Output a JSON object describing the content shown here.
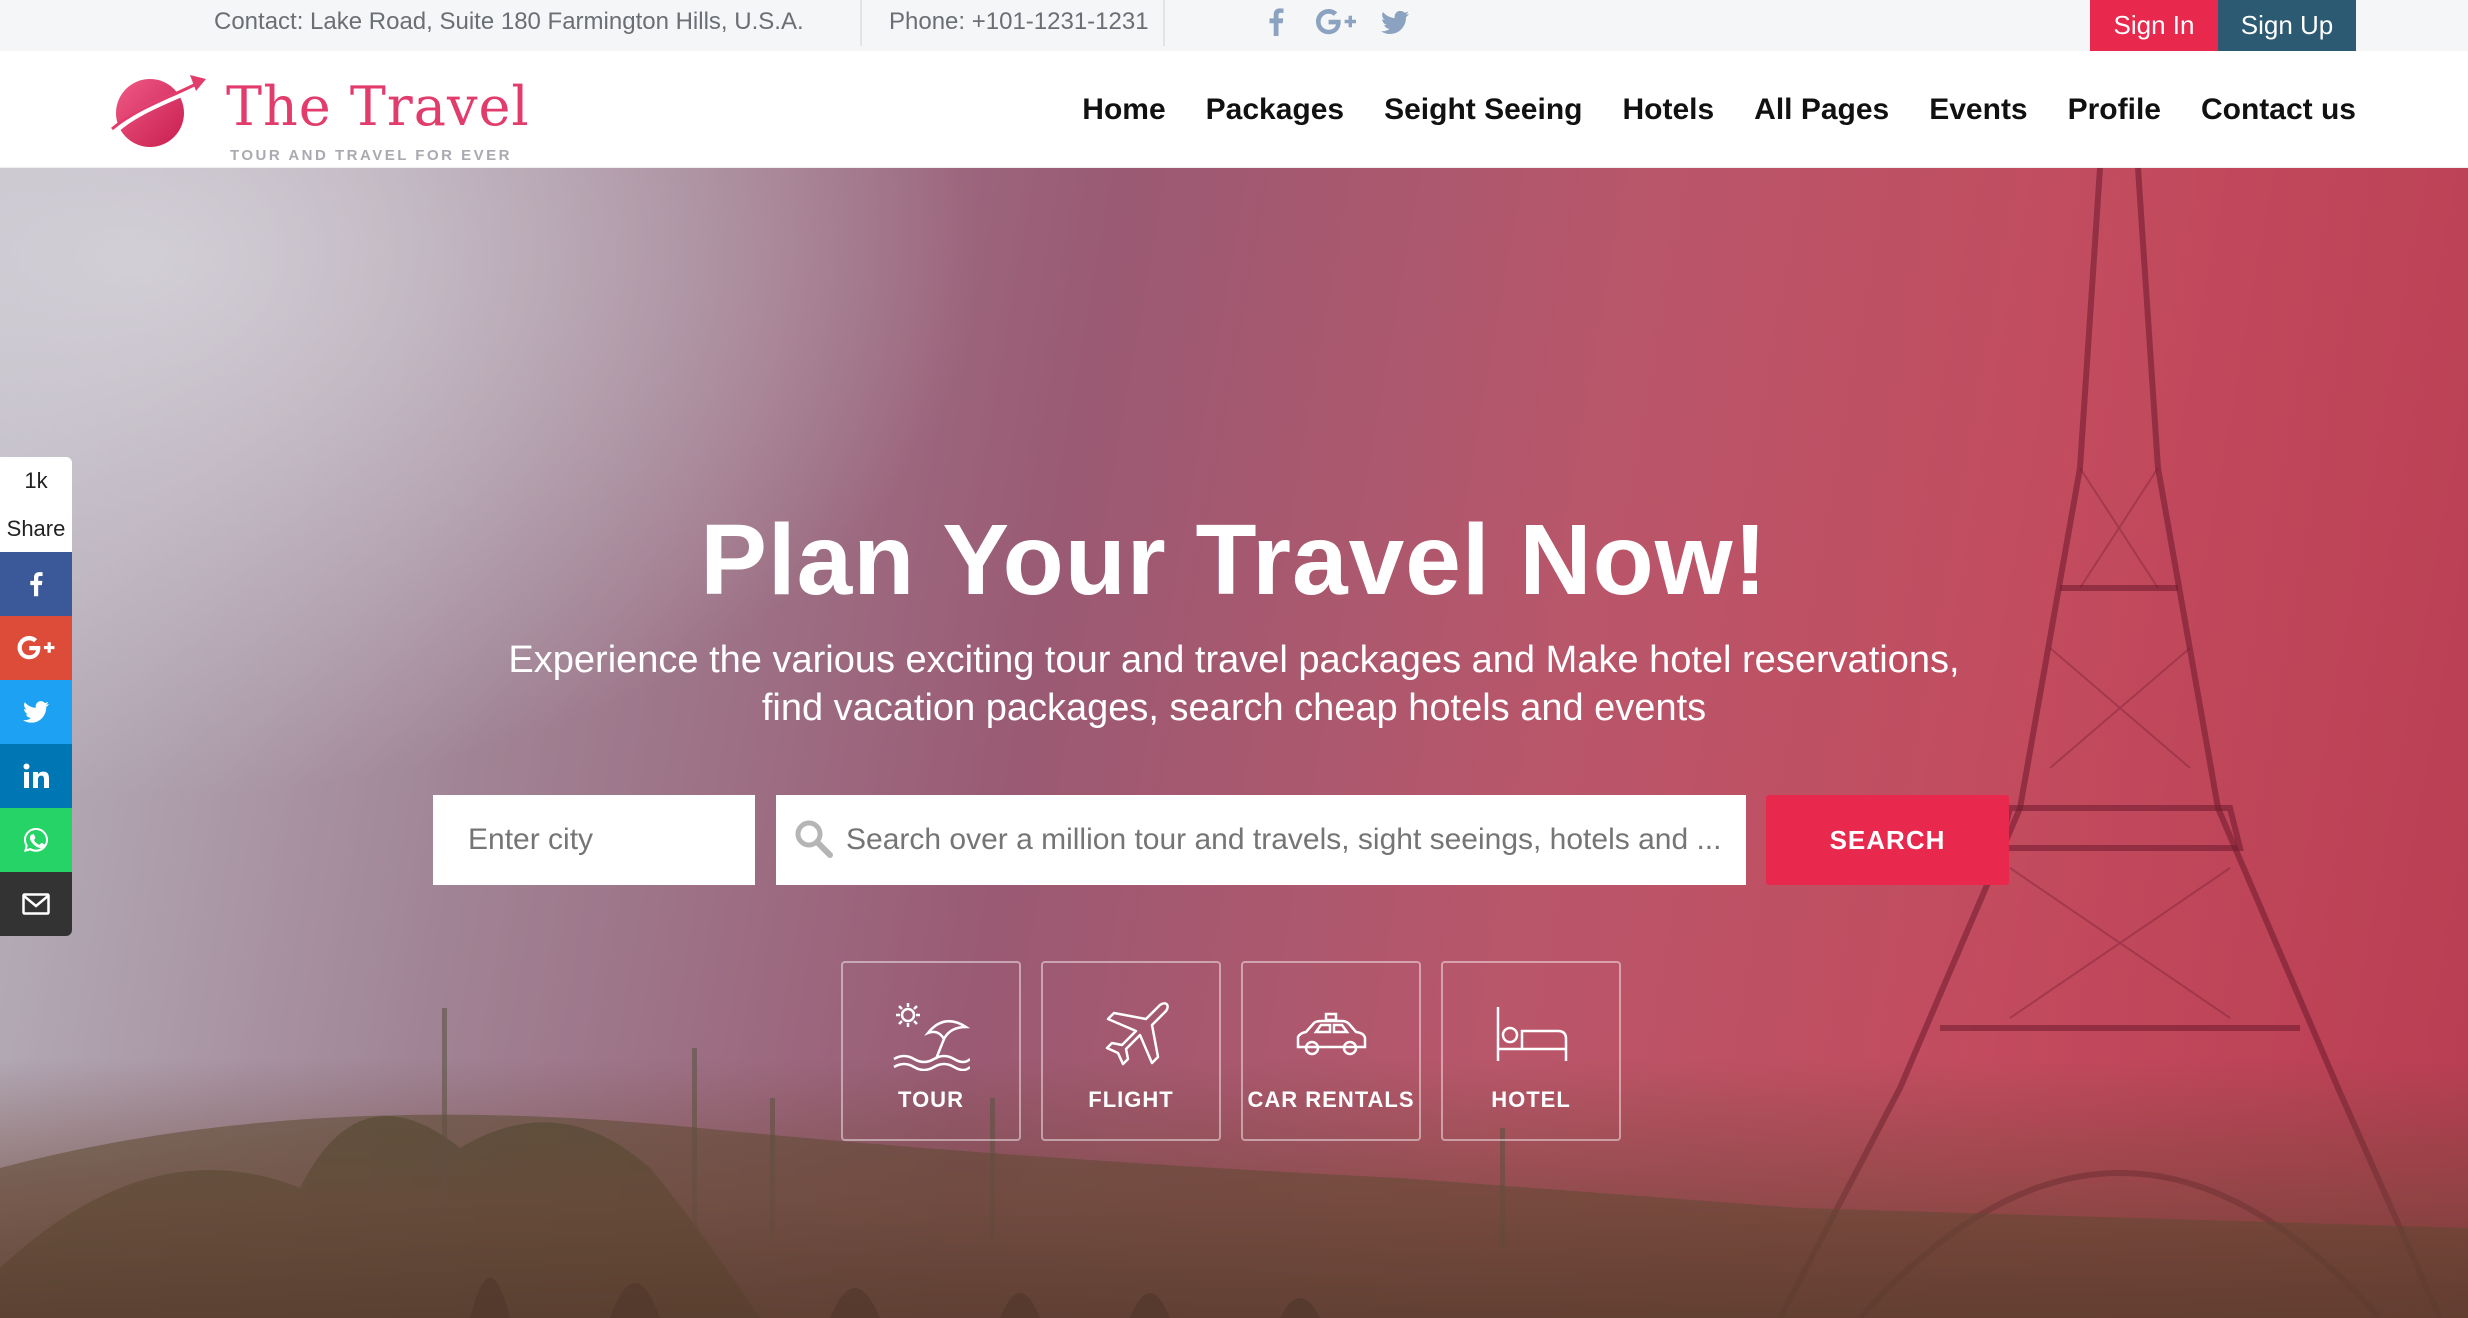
{
  "topbar": {
    "contact": "Contact: Lake Road, Suite 180 Farmington Hills, U.S.A.",
    "phone": "Phone: +101-1231-1231",
    "social_icons": [
      "facebook-icon",
      "google-plus-icon",
      "twitter-icon"
    ],
    "signin_label": "Sign In",
    "signup_label": "Sign Up"
  },
  "logo": {
    "name": "The Travel",
    "tagline": "TOUR AND TRAVEL FOR EVER"
  },
  "nav": {
    "items": [
      "Home",
      "Packages",
      "Seight Seeing",
      "Hotels",
      "All Pages",
      "Events",
      "Profile",
      "Contact us"
    ]
  },
  "hero": {
    "title": "Plan Your Travel Now!",
    "subtitle_line1": "Experience the various exciting tour and travel packages and Make hotel reservations,",
    "subtitle_line2": "find vacation packages, search cheap hotels and events",
    "city_placeholder": "Enter city",
    "search_placeholder": "Search over a million tour and travels, sight seeings, hotels and ...",
    "search_button": "SEARCH",
    "categories": [
      {
        "label": "TOUR",
        "icon": "beach-umbrella-icon"
      },
      {
        "label": "FLIGHT",
        "icon": "airplane-icon"
      },
      {
        "label": "CAR RENTALS",
        "icon": "car-icon"
      },
      {
        "label": "HOTEL",
        "icon": "bed-icon"
      }
    ]
  },
  "share_bar": {
    "count": "1k",
    "label": "Share",
    "buttons": [
      {
        "icon": "facebook-icon",
        "color": "#3b5998"
      },
      {
        "icon": "google-plus-icon",
        "color": "#dd4b39"
      },
      {
        "icon": "twitter-icon",
        "color": "#1da1f2"
      },
      {
        "icon": "linkedin-icon",
        "color": "#0077b5"
      },
      {
        "icon": "whatsapp-icon",
        "color": "#25d366"
      },
      {
        "icon": "email-icon",
        "color": "#333333"
      }
    ]
  },
  "colors": {
    "accent": "#e8284d",
    "signup": "#2c5a72",
    "logo": "#e23c6c"
  }
}
